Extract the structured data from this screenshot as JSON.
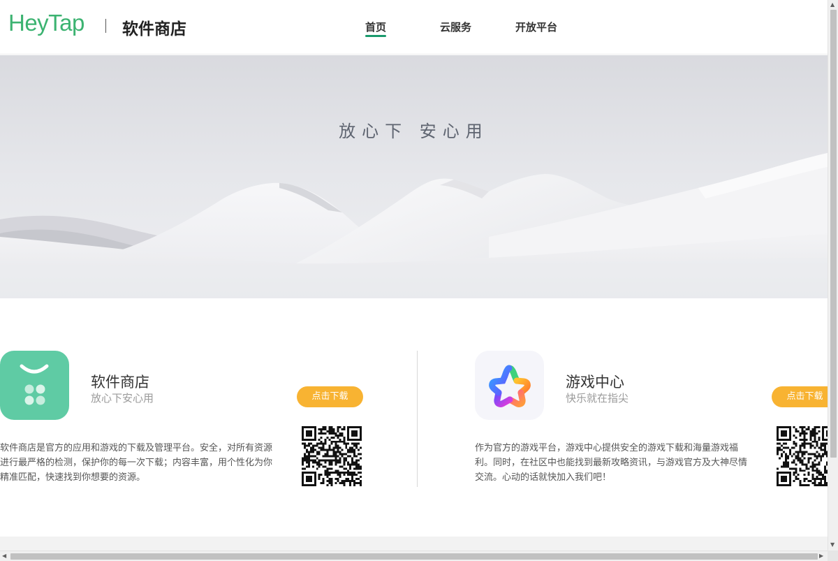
{
  "header": {
    "logo": "HeyTap",
    "site_title": "软件商店",
    "nav": [
      {
        "label": "首页",
        "active": true
      },
      {
        "label": "云服务",
        "active": false
      },
      {
        "label": "开放平台",
        "active": false
      }
    ],
    "accent_color": "#1a9a6c",
    "logo_color": "#3cb371"
  },
  "banner": {
    "slogan": "放心下  安心用"
  },
  "products": [
    {
      "name": "软件商店",
      "tagline": "放心下安心用",
      "button": "点击下载",
      "description": "软件商店是官方的应用和游戏的下载及管理平台。安全，对所有资源进行最严格的检测，保护你的每一次下载；内容丰富，用个性化为你精准匹配，快速找到你想要的资源。",
      "icon": "app-store-icon",
      "qr": "download-qr-code"
    },
    {
      "name": "游戏中心",
      "tagline": "快乐就在指尖",
      "button": "点击下载",
      "description": "作为官方的游戏平台，游戏中心提供安全的游戏下载和海量游戏福利。同时，在社区中也能找到最新攻略资讯，与游戏官方及大神尽情交流。心动的话就快加入我们吧！",
      "icon": "game-center-icon",
      "qr": "download-qr-code"
    }
  ],
  "button_color": "#f8b332",
  "scrollbar": {
    "up_icon": "scroll-up-arrow-icon",
    "down_icon": "scroll-down-arrow-icon",
    "left_icon": "scroll-left-arrow-icon",
    "right_icon": "scroll-right-arrow-icon"
  }
}
